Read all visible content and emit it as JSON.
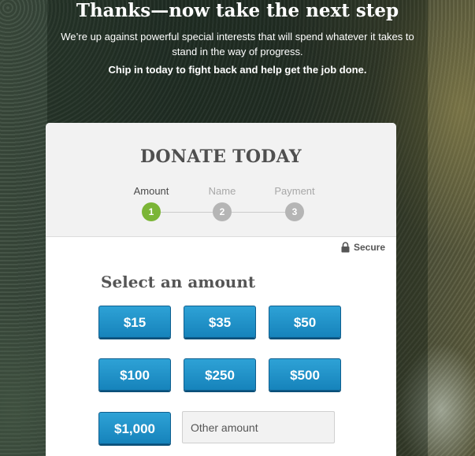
{
  "hero": {
    "title": "Thanks—now take the next step",
    "subtitle": "We’re up against powerful special interests that will spend whatever it takes to stand in the way of progress.",
    "cta": "Chip in today to fight back and help get the job done."
  },
  "card": {
    "title": "DONATE TODAY",
    "steps": [
      {
        "label": "Amount",
        "number": "1"
      },
      {
        "label": "Name",
        "number": "2"
      },
      {
        "label": "Payment",
        "number": "3"
      }
    ],
    "secure_label": "Secure",
    "select_heading": "Select an amount",
    "amounts": [
      "$15",
      "$35",
      "$50",
      "$100",
      "$250",
      "$500",
      "$1,000"
    ],
    "other_amount_placeholder": "Other amount"
  },
  "colors": {
    "active_step": "#7bb536",
    "inactive_step": "#b5b5b5",
    "button_blue": "#1c8fc6"
  }
}
